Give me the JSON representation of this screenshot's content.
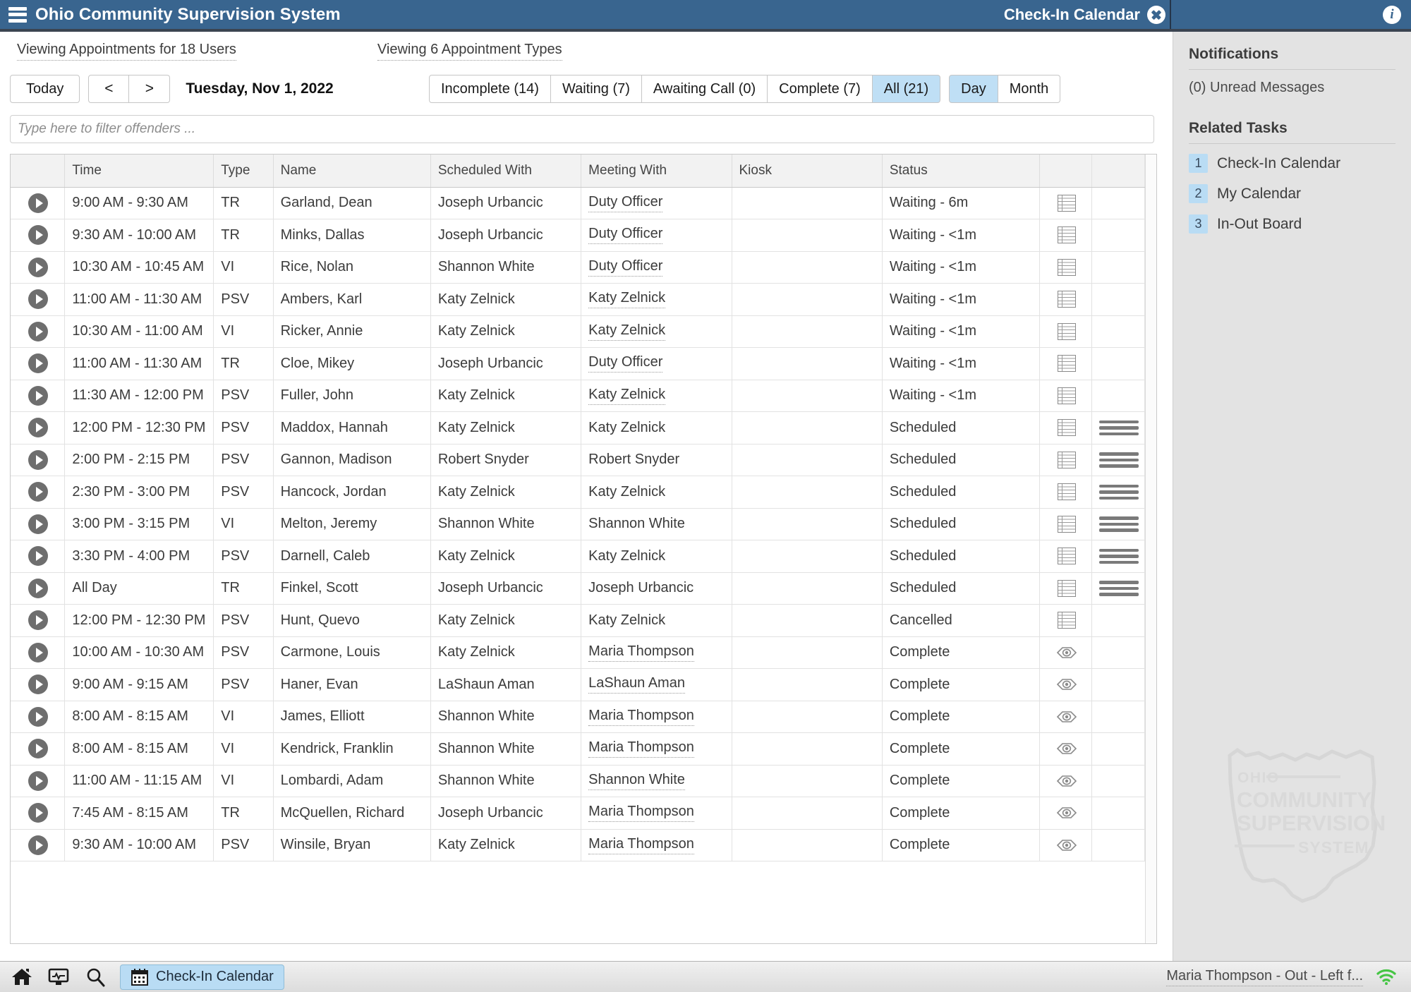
{
  "titlebar": {
    "app_title": "Ohio Community Supervision System",
    "window_title": "Check-In Calendar",
    "menu_icon": "hamburger-icon",
    "close_icon": "close-icon",
    "info_icon": "info-icon"
  },
  "filters": {
    "viewing_users": "Viewing Appointments for 18 Users",
    "viewing_types": "Viewing 6 Appointment Types"
  },
  "toolbar": {
    "today": "Today",
    "prev": "<",
    "next": ">",
    "date": "Tuesday, Nov 1, 2022",
    "status_tabs": [
      {
        "label": "Incomplete (14)",
        "active": false
      },
      {
        "label": "Waiting (7)",
        "active": false
      },
      {
        "label": "Awaiting Call (0)",
        "active": false
      },
      {
        "label": "Complete (7)",
        "active": false
      },
      {
        "label": "All (21)",
        "active": true
      }
    ],
    "view_tabs": [
      {
        "label": "Day",
        "active": true
      },
      {
        "label": "Month",
        "active": false
      }
    ]
  },
  "search": {
    "placeholder": "Type here to filter offenders ...",
    "value": ""
  },
  "table": {
    "columns": [
      "",
      "Time",
      "Type",
      "Name",
      "Scheduled With",
      "Meeting With",
      "Kiosk",
      "Status",
      "",
      ""
    ],
    "rows": [
      {
        "time": "9:00 AM - 9:30 AM",
        "type": "TR",
        "name": "Garland, Dean",
        "scheduled_with": "Joseph Urbancic",
        "meeting_with": "Duty Officer",
        "meeting_link": true,
        "kiosk": "",
        "status": "Waiting - 6m",
        "icon1": "note-icon",
        "icon2": ""
      },
      {
        "time": "9:30 AM - 10:00 AM",
        "type": "TR",
        "name": "Minks, Dallas",
        "scheduled_with": "Joseph Urbancic",
        "meeting_with": "Duty Officer",
        "meeting_link": true,
        "kiosk": "",
        "status": "Waiting - <1m",
        "icon1": "note-icon",
        "icon2": ""
      },
      {
        "time": "10:30 AM - 10:45 AM",
        "type": "VI",
        "name": "Rice, Nolan",
        "scheduled_with": "Shannon White",
        "meeting_with": "Duty Officer",
        "meeting_link": true,
        "kiosk": "",
        "status": "Waiting - <1m",
        "icon1": "note-icon",
        "icon2": ""
      },
      {
        "time": "11:00 AM - 11:30 AM",
        "type": "PSV",
        "name": "Ambers, Karl",
        "scheduled_with": "Katy Zelnick",
        "meeting_with": "Katy Zelnick",
        "meeting_link": true,
        "kiosk": "",
        "status": "Waiting - <1m",
        "icon1": "note-icon",
        "icon2": ""
      },
      {
        "time": "10:30 AM - 11:00 AM",
        "type": "VI",
        "name": "Ricker, Annie",
        "scheduled_with": "Katy Zelnick",
        "meeting_with": "Katy Zelnick",
        "meeting_link": true,
        "kiosk": "",
        "status": "Waiting - <1m",
        "icon1": "note-icon",
        "icon2": ""
      },
      {
        "time": "11:00 AM - 11:30 AM",
        "type": "TR",
        "name": "Cloe, Mikey",
        "scheduled_with": "Joseph Urbancic",
        "meeting_with": "Duty Officer",
        "meeting_link": true,
        "kiosk": "",
        "status": "Waiting - <1m",
        "icon1": "note-icon",
        "icon2": ""
      },
      {
        "time": "11:30 AM - 12:00 PM",
        "type": "PSV",
        "name": "Fuller, John",
        "scheduled_with": "Katy Zelnick",
        "meeting_with": "Katy Zelnick",
        "meeting_link": true,
        "kiosk": "",
        "status": "Waiting - <1m",
        "icon1": "note-icon",
        "icon2": ""
      },
      {
        "time": "12:00 PM - 12:30 PM",
        "type": "PSV",
        "name": "Maddox, Hannah",
        "scheduled_with": "Katy Zelnick",
        "meeting_with": "Katy Zelnick",
        "meeting_link": false,
        "kiosk": "",
        "status": "Scheduled",
        "icon1": "note-icon",
        "icon2": "menu-icon"
      },
      {
        "time": "2:00 PM - 2:15 PM",
        "type": "PSV",
        "name": "Gannon, Madison",
        "scheduled_with": "Robert Snyder",
        "meeting_with": "Robert Snyder",
        "meeting_link": false,
        "kiosk": "",
        "status": "Scheduled",
        "icon1": "note-icon",
        "icon2": "menu-icon"
      },
      {
        "time": "2:30 PM - 3:00 PM",
        "type": "PSV",
        "name": "Hancock, Jordan",
        "scheduled_with": "Katy Zelnick",
        "meeting_with": "Katy Zelnick",
        "meeting_link": false,
        "kiosk": "",
        "status": "Scheduled",
        "icon1": "note-icon",
        "icon2": "menu-icon"
      },
      {
        "time": "3:00 PM - 3:15 PM",
        "type": "VI",
        "name": "Melton, Jeremy",
        "scheduled_with": "Shannon White",
        "meeting_with": "Shannon White",
        "meeting_link": false,
        "kiosk": "",
        "status": "Scheduled",
        "icon1": "note-icon",
        "icon2": "menu-icon"
      },
      {
        "time": "3:30 PM - 4:00 PM",
        "type": "PSV",
        "name": "Darnell, Caleb",
        "scheduled_with": "Katy Zelnick",
        "meeting_with": "Katy Zelnick",
        "meeting_link": false,
        "kiosk": "",
        "status": "Scheduled",
        "icon1": "note-icon",
        "icon2": "menu-icon"
      },
      {
        "time": "All Day",
        "type": "TR",
        "name": "Finkel, Scott",
        "scheduled_with": "Joseph Urbancic",
        "meeting_with": "Joseph Urbancic",
        "meeting_link": false,
        "kiosk": "",
        "status": "Scheduled",
        "icon1": "note-icon",
        "icon2": "menu-icon"
      },
      {
        "time": "12:00 PM - 12:30 PM",
        "type": "PSV",
        "name": "Hunt, Quevo",
        "scheduled_with": "Katy Zelnick",
        "meeting_with": "Katy Zelnick",
        "meeting_link": false,
        "kiosk": "",
        "status": "Cancelled",
        "icon1": "note-icon",
        "icon2": ""
      },
      {
        "time": "10:00 AM - 10:30 AM",
        "type": "PSV",
        "name": "Carmone, Louis",
        "scheduled_with": "Katy Zelnick",
        "meeting_with": "Maria Thompson",
        "meeting_link": true,
        "kiosk": "",
        "status": "Complete",
        "icon1": "eye-icon",
        "icon2": ""
      },
      {
        "time": "9:00 AM - 9:15 AM",
        "type": "PSV",
        "name": "Haner, Evan",
        "scheduled_with": "LaShaun Aman",
        "meeting_with": "LaShaun Aman",
        "meeting_link": true,
        "kiosk": "",
        "status": "Complete",
        "icon1": "eye-icon",
        "icon2": ""
      },
      {
        "time": "8:00 AM - 8:15 AM",
        "type": "VI",
        "name": "James, Elliott",
        "scheduled_with": "Shannon White",
        "meeting_with": "Maria Thompson",
        "meeting_link": true,
        "kiosk": "",
        "status": "Complete",
        "icon1": "eye-icon",
        "icon2": ""
      },
      {
        "time": "8:00 AM - 8:15 AM",
        "type": "VI",
        "name": "Kendrick, Franklin",
        "scheduled_with": "Shannon White",
        "meeting_with": "Maria Thompson",
        "meeting_link": true,
        "kiosk": "",
        "status": "Complete",
        "icon1": "eye-icon",
        "icon2": ""
      },
      {
        "time": "11:00 AM - 11:15 AM",
        "type": "VI",
        "name": "Lombardi, Adam",
        "scheduled_with": "Shannon White",
        "meeting_with": "Shannon White",
        "meeting_link": true,
        "kiosk": "",
        "status": "Complete",
        "icon1": "eye-icon",
        "icon2": ""
      },
      {
        "time": "7:45 AM - 8:15 AM",
        "type": "TR",
        "name": "McQuellen, Richard",
        "scheduled_with": "Joseph Urbancic",
        "meeting_with": "Maria Thompson",
        "meeting_link": true,
        "kiosk": "",
        "status": "Complete",
        "icon1": "eye-icon",
        "icon2": ""
      },
      {
        "time": "9:30 AM - 10:00 AM",
        "type": "PSV",
        "name": "Winsile, Bryan",
        "scheduled_with": "Katy Zelnick",
        "meeting_with": "Maria Thompson",
        "meeting_link": true,
        "kiosk": "",
        "status": "Complete",
        "icon1": "eye-icon",
        "icon2": ""
      }
    ]
  },
  "sidebar": {
    "notifications_heading": "Notifications",
    "unread_messages": "(0) Unread Messages",
    "related_tasks_heading": "Related Tasks",
    "tasks": [
      {
        "num": "1",
        "label": "Check-In Calendar"
      },
      {
        "num": "2",
        "label": "My Calendar"
      },
      {
        "num": "3",
        "label": "In-Out Board"
      }
    ],
    "watermark": {
      "line1": "OHIO",
      "line2": "COMMUNITY",
      "line3": "SUPERVISION",
      "line4": "SYSTEM"
    }
  },
  "taskbar": {
    "icons": [
      "home-icon",
      "monitor-icon",
      "search-icon"
    ],
    "active_task": "Check-In Calendar",
    "task_icon": "calendar-icon",
    "status_user": "Maria Thompson - Out - Left f...",
    "wifi_icon": "wifi-icon"
  },
  "colors": {
    "titlebar": "#39658f",
    "accent_active": "#bfdff5",
    "sidebar_bg": "#e3e3e3",
    "wifi_green": "#45c544"
  }
}
